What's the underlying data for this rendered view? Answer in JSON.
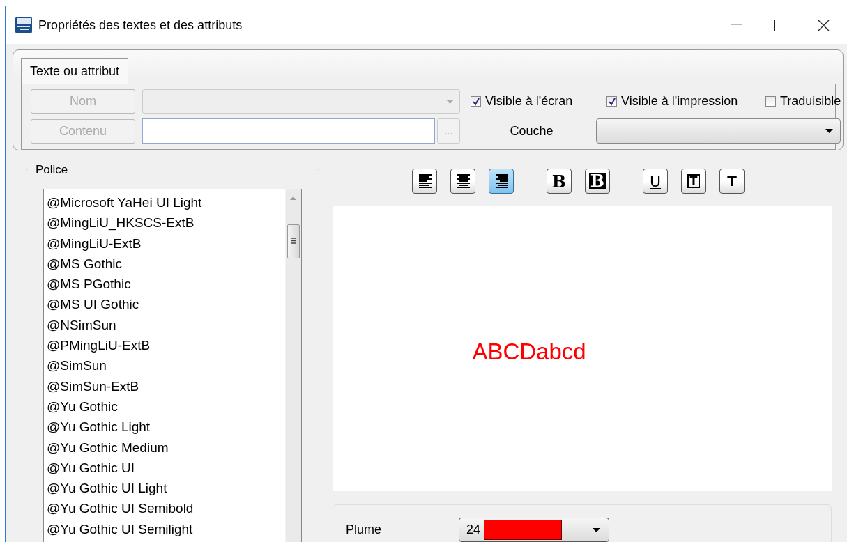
{
  "window": {
    "title": "Propriétés des textes et des attributs"
  },
  "tabs": [
    {
      "label": "Texte ou attribut",
      "selected": true
    }
  ],
  "name_button": {
    "label": "Nom",
    "disabled": true
  },
  "content_button": {
    "label": "Contenu",
    "disabled": true
  },
  "browse_button": {
    "label": "...",
    "disabled": true
  },
  "checkboxes": [
    {
      "label": "Visible à l'écran",
      "checked": true
    },
    {
      "label": "Visible à l'impression",
      "checked": true
    },
    {
      "label": "Traduisible",
      "checked": false
    }
  ],
  "layer": {
    "label": "Couche"
  },
  "font_group": {
    "title": "Police"
  },
  "fonts": [
    {
      "label": "@Microsoft YaHei UI Light"
    },
    {
      "label": "@MingLiU_HKSCS-ExtB"
    },
    {
      "label": "@MingLiU-ExtB"
    },
    {
      "label": "@MS Gothic"
    },
    {
      "label": "@MS PGothic"
    },
    {
      "label": "@MS UI Gothic"
    },
    {
      "label": "@NSimSun"
    },
    {
      "label": "@PMingLiU-ExtB"
    },
    {
      "label": "@SimSun"
    },
    {
      "label": "@SimSun-ExtB"
    },
    {
      "label": "@Yu Gothic"
    },
    {
      "label": "@Yu Gothic Light"
    },
    {
      "label": "@Yu Gothic Medium"
    },
    {
      "label": "@Yu Gothic UI"
    },
    {
      "label": "@Yu Gothic UI Light"
    },
    {
      "label": "@Yu Gothic UI Semibold"
    },
    {
      "label": "@Yu Gothic UI Semilight"
    }
  ],
  "format_buttons": [
    {
      "kind": "align-left",
      "selected": false
    },
    {
      "kind": "align-center",
      "selected": false
    },
    {
      "kind": "align-right",
      "selected": true
    },
    {
      "kind": "bold",
      "label": "B",
      "selected": false
    },
    {
      "kind": "bold-box",
      "label": "B",
      "selected": false
    },
    {
      "kind": "underline",
      "label": "U",
      "selected": false
    },
    {
      "kind": "frame",
      "label": "T",
      "selected": false
    },
    {
      "kind": "plain",
      "label": "T",
      "selected": false
    }
  ],
  "preview": {
    "text": "ABCDabcd"
  },
  "pen": {
    "label": "Plume",
    "value": "24",
    "color": "#ff0000"
  }
}
